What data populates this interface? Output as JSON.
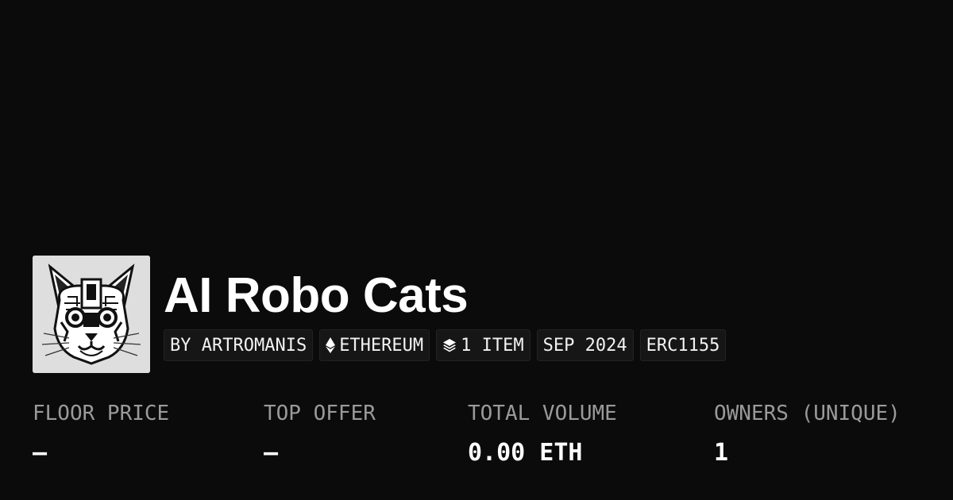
{
  "collection": {
    "name": "AI Robo Cats",
    "avatar_icon": "robot-cat-logo-icon"
  },
  "badges": [
    {
      "label": "BY ARTROMANIS",
      "icon": null
    },
    {
      "label": "ETHEREUM",
      "icon": "ethereum-icon"
    },
    {
      "label": "1 ITEM",
      "icon": "layers-icon"
    },
    {
      "label": "SEP 2024",
      "icon": null
    },
    {
      "label": "ERC1155",
      "icon": null
    }
  ],
  "stats": [
    {
      "label": "FLOOR PRICE",
      "value": "—"
    },
    {
      "label": "TOP OFFER",
      "value": "—"
    },
    {
      "label": "TOTAL VOLUME",
      "value": "0.00 ETH"
    },
    {
      "label": "OWNERS (UNIQUE)",
      "value": "1"
    }
  ],
  "colors": {
    "background": "#0b0b0b",
    "badge_background": "#161616",
    "label_gray": "#9a9a9a",
    "text": "#ffffff"
  }
}
